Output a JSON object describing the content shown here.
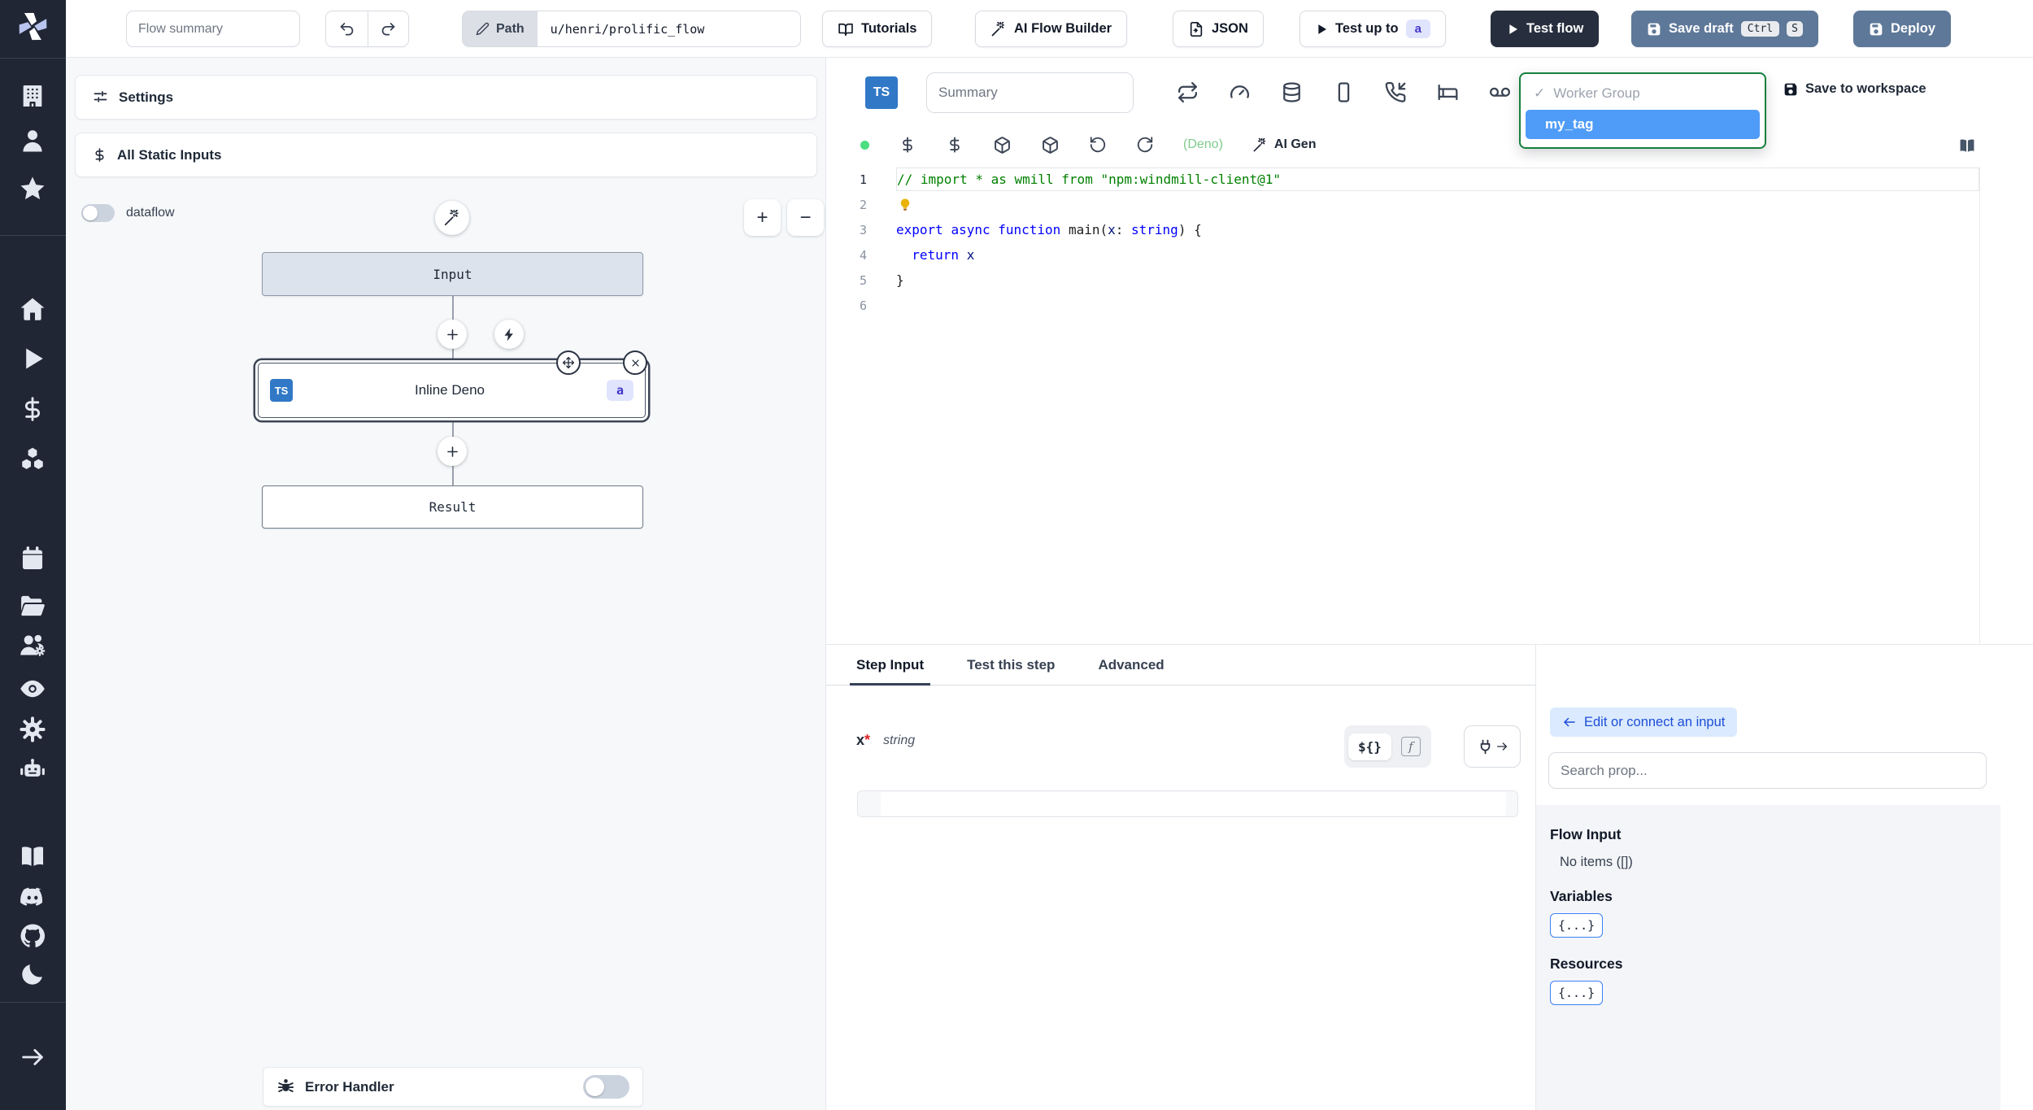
{
  "topbar": {
    "flow_summary_placeholder": "Flow summary",
    "path": {
      "label": "Path",
      "value": "u/henri/prolific_flow"
    },
    "buttons": {
      "tutorials": "Tutorials",
      "ai_flow_builder": "AI Flow Builder",
      "json": "JSON",
      "test_up_to": "Test up to",
      "test_up_to_badge": "a",
      "test_flow": "Test flow",
      "save_draft": "Save draft",
      "save_draft_keys": {
        "k1": "Ctrl",
        "k2": "S"
      },
      "deploy": "Deploy"
    }
  },
  "sidebar": {
    "items": [
      "windmill-logo",
      "building",
      "user",
      "star",
      "home",
      "play",
      "dollar",
      "boxes",
      "calendar",
      "folder-open",
      "users-gear",
      "eye",
      "gear",
      "robot",
      "book",
      "discord",
      "github",
      "moon",
      "arrow-right"
    ]
  },
  "flow_panel": {
    "settings_label": "Settings",
    "all_static_inputs_label": "All Static Inputs",
    "dataflow_label": "dataflow",
    "zoom_in_label": "+",
    "zoom_out_label": "−",
    "nodes": {
      "input_label": "Input",
      "step": {
        "lang_badge": "TS",
        "label": "Inline Deno",
        "id_badge": "a"
      },
      "result_label": "Result"
    },
    "error_handler_label": "Error Handler"
  },
  "editor": {
    "lang_badge": "TS",
    "summary_placeholder": "Summary",
    "toolbar_icons": [
      "repeat",
      "gauge",
      "database",
      "mobile",
      "phone-incoming",
      "bed",
      "voicemail"
    ],
    "status_row": {
      "lang_hint": "(Deno)",
      "ai_gen_label": "AI Gen"
    },
    "save_to_workspace_label": "Save to workspace",
    "worker_group_menu": {
      "check": "✓",
      "group_label": "Worker Group",
      "selected_option": "my_tag"
    },
    "code": {
      "lines": [
        {
          "num": "1",
          "active": true,
          "tokens": [
            [
              "comment",
              "// import * as wmill from \"npm:windmill-client@1\""
            ]
          ]
        },
        {
          "num": "2",
          "bulb": true,
          "tokens": []
        },
        {
          "num": "3",
          "tokens": [
            [
              "kw",
              "export"
            ],
            [
              "plain",
              " "
            ],
            [
              "kw",
              "async"
            ],
            [
              "plain",
              " "
            ],
            [
              "kw",
              "function"
            ],
            [
              "plain",
              " main("
            ],
            [
              "var",
              "x"
            ],
            [
              "plain",
              ": "
            ],
            [
              "kw",
              "string"
            ],
            [
              "plain",
              ") {"
            ]
          ]
        },
        {
          "num": "4",
          "tokens": [
            [
              "plain",
              "  "
            ],
            [
              "kw",
              "return"
            ],
            [
              "var",
              " x"
            ]
          ]
        },
        {
          "num": "5",
          "tokens": [
            [
              "plain",
              "}"
            ]
          ]
        },
        {
          "num": "6",
          "tokens": []
        }
      ]
    }
  },
  "step_panel": {
    "tabs": [
      {
        "label": "Step Input",
        "active": true
      },
      {
        "label": "Test this step",
        "active": false
      },
      {
        "label": "Advanced",
        "active": false
      }
    ],
    "field": {
      "name": "x",
      "required_marker": "*",
      "type": "string"
    },
    "toggles": {
      "template": "${}",
      "fn": "f"
    },
    "connect_panel": {
      "back_chip": "Edit or connect an input",
      "search_placeholder": "Search prop...",
      "sections": [
        {
          "title": "Flow Input",
          "empty_text": "No items ([])"
        },
        {
          "title": "Variables",
          "chip": "{...}"
        },
        {
          "title": "Resources",
          "chip": "{...}"
        }
      ]
    }
  },
  "colors": {
    "sidebar_bg": "#202634",
    "ts_badge_blue": "#3178c6",
    "selected_tag_bg": "#4f9cf8",
    "dropdown_border_green": "#15803d",
    "status_dot_green": "#4ade80",
    "deno_hint_green": "#7fcb8b",
    "badge_indigo_bg": "#e0e4fc",
    "badge_indigo_text": "#4338ca",
    "slate_button": "#5e7899",
    "dark_button": "#272e3d"
  }
}
